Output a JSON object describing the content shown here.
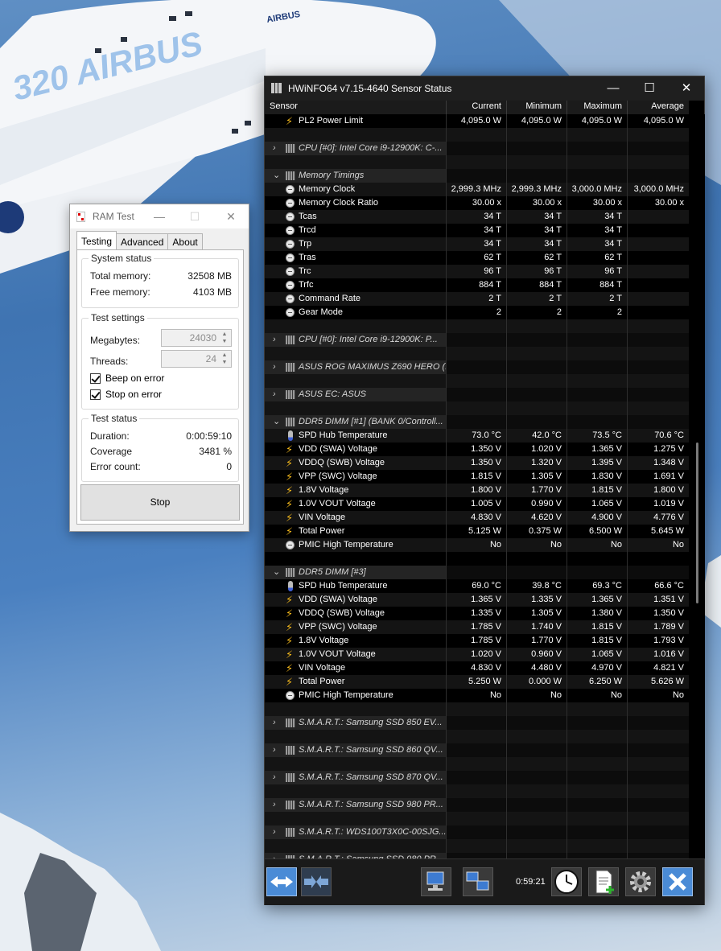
{
  "desktop": {
    "livery_large": "320 AIRBUS",
    "livery_small": "AIRBUS"
  },
  "ramtest": {
    "title": "RAM Test",
    "tabs": [
      "Testing",
      "Advanced",
      "About"
    ],
    "system_status": {
      "label": "System status",
      "total_label": "Total memory:",
      "total_value": "32508 MB",
      "free_label": "Free memory:",
      "free_value": "4103 MB"
    },
    "test_settings": {
      "label": "Test settings",
      "megabytes_label": "Megabytes:",
      "megabytes_value": "24030",
      "threads_label": "Threads:",
      "threads_value": "24",
      "beep_label": "Beep on error",
      "beep_checked": true,
      "stop_label": "Stop on error",
      "stop_checked": true
    },
    "test_status": {
      "label": "Test status",
      "duration_label": "Duration:",
      "duration_value": "0:00:59:10",
      "coverage_label": "Coverage",
      "coverage_value": "3481 %",
      "errors_label": "Error count:",
      "errors_value": "0"
    },
    "stop_button": "Stop"
  },
  "hwinfo": {
    "title": "HWiNFO64 v7.15-4640 Sensor Status",
    "columns": [
      "Sensor",
      "Current",
      "Minimum",
      "Maximum",
      "Average"
    ],
    "timer": "0:59:21",
    "rows": [
      {
        "type": "sensor",
        "icon": "bolt",
        "name": "PL2 Power Limit",
        "v": [
          "4,095.0 W",
          "4,095.0 W",
          "4,095.0 W",
          "4,095.0 W"
        ]
      },
      {
        "type": "blank"
      },
      {
        "type": "group",
        "expanded": false,
        "name": "CPU [#0]: Intel Core i9-12900K: C-..."
      },
      {
        "type": "blank"
      },
      {
        "type": "group",
        "expanded": true,
        "name": "Memory Timings"
      },
      {
        "type": "sensor",
        "icon": "clock",
        "name": "Memory Clock",
        "v": [
          "2,999.3 MHz",
          "2,999.3 MHz",
          "3,000.0 MHz",
          "3,000.0 MHz"
        ]
      },
      {
        "type": "sensor",
        "icon": "clock",
        "name": "Memory Clock Ratio",
        "v": [
          "30.00 x",
          "30.00 x",
          "30.00 x",
          "30.00 x"
        ]
      },
      {
        "type": "sensor",
        "icon": "clock",
        "name": "Tcas",
        "v": [
          "34 T",
          "34 T",
          "34 T",
          ""
        ]
      },
      {
        "type": "sensor",
        "icon": "clock",
        "name": "Trcd",
        "v": [
          "34 T",
          "34 T",
          "34 T",
          ""
        ]
      },
      {
        "type": "sensor",
        "icon": "clock",
        "name": "Trp",
        "v": [
          "34 T",
          "34 T",
          "34 T",
          ""
        ]
      },
      {
        "type": "sensor",
        "icon": "clock",
        "name": "Tras",
        "v": [
          "62 T",
          "62 T",
          "62 T",
          ""
        ]
      },
      {
        "type": "sensor",
        "icon": "clock",
        "name": "Trc",
        "v": [
          "96 T",
          "96 T",
          "96 T",
          ""
        ]
      },
      {
        "type": "sensor",
        "icon": "clock",
        "name": "Trfc",
        "v": [
          "884 T",
          "884 T",
          "884 T",
          ""
        ]
      },
      {
        "type": "sensor",
        "icon": "clock",
        "name": "Command Rate",
        "v": [
          "2 T",
          "2 T",
          "2 T",
          ""
        ]
      },
      {
        "type": "sensor",
        "icon": "clock",
        "name": "Gear Mode",
        "v": [
          "2",
          "2",
          "2",
          ""
        ]
      },
      {
        "type": "blank"
      },
      {
        "type": "group",
        "expanded": false,
        "name": "CPU [#0]: Intel Core i9-12900K: P..."
      },
      {
        "type": "blank"
      },
      {
        "type": "group",
        "expanded": false,
        "name": "ASUS ROG MAXIMUS Z690 HERO (..."
      },
      {
        "type": "blank"
      },
      {
        "type": "group",
        "expanded": false,
        "name": "ASUS EC: ASUS"
      },
      {
        "type": "blank"
      },
      {
        "type": "group",
        "expanded": true,
        "name": "DDR5 DIMM [#1] (BANK 0/Controll..."
      },
      {
        "type": "sensor",
        "icon": "therm",
        "name": "SPD Hub Temperature",
        "v": [
          "73.0 °C",
          "42.0 °C",
          "73.5 °C",
          "70.6 °C"
        ]
      },
      {
        "type": "sensor",
        "icon": "bolt",
        "name": "VDD (SWA) Voltage",
        "v": [
          "1.350 V",
          "1.020 V",
          "1.365 V",
          "1.275 V"
        ]
      },
      {
        "type": "sensor",
        "icon": "bolt",
        "name": "VDDQ (SWB) Voltage",
        "v": [
          "1.350 V",
          "1.320 V",
          "1.395 V",
          "1.348 V"
        ]
      },
      {
        "type": "sensor",
        "icon": "bolt",
        "name": "VPP (SWC) Voltage",
        "v": [
          "1.815 V",
          "1.305 V",
          "1.830 V",
          "1.691 V"
        ]
      },
      {
        "type": "sensor",
        "icon": "bolt",
        "name": "1.8V Voltage",
        "v": [
          "1.800 V",
          "1.770 V",
          "1.815 V",
          "1.800 V"
        ]
      },
      {
        "type": "sensor",
        "icon": "bolt",
        "name": "1.0V VOUT Voltage",
        "v": [
          "1.005 V",
          "0.990 V",
          "1.065 V",
          "1.019 V"
        ]
      },
      {
        "type": "sensor",
        "icon": "bolt",
        "name": "VIN Voltage",
        "v": [
          "4.830 V",
          "4.620 V",
          "4.900 V",
          "4.776 V"
        ]
      },
      {
        "type": "sensor",
        "icon": "bolt",
        "name": "Total Power",
        "v": [
          "5.125 W",
          "0.375 W",
          "6.500 W",
          "5.645 W"
        ]
      },
      {
        "type": "sensor",
        "icon": "clock",
        "name": "PMIC High Temperature",
        "v": [
          "No",
          "No",
          "No",
          "No"
        ]
      },
      {
        "type": "blank"
      },
      {
        "type": "group",
        "expanded": true,
        "name": "DDR5 DIMM [#3]"
      },
      {
        "type": "sensor",
        "icon": "therm",
        "name": "SPD Hub Temperature",
        "v": [
          "69.0 °C",
          "39.8 °C",
          "69.3 °C",
          "66.6 °C"
        ]
      },
      {
        "type": "sensor",
        "icon": "bolt",
        "name": "VDD (SWA) Voltage",
        "v": [
          "1.365 V",
          "1.335 V",
          "1.365 V",
          "1.351 V"
        ]
      },
      {
        "type": "sensor",
        "icon": "bolt",
        "name": "VDDQ (SWB) Voltage",
        "v": [
          "1.335 V",
          "1.305 V",
          "1.380 V",
          "1.350 V"
        ]
      },
      {
        "type": "sensor",
        "icon": "bolt",
        "name": "VPP (SWC) Voltage",
        "v": [
          "1.785 V",
          "1.740 V",
          "1.815 V",
          "1.789 V"
        ]
      },
      {
        "type": "sensor",
        "icon": "bolt",
        "name": "1.8V Voltage",
        "v": [
          "1.785 V",
          "1.770 V",
          "1.815 V",
          "1.793 V"
        ]
      },
      {
        "type": "sensor",
        "icon": "bolt",
        "name": "1.0V VOUT Voltage",
        "v": [
          "1.020 V",
          "0.960 V",
          "1.065 V",
          "1.016 V"
        ]
      },
      {
        "type": "sensor",
        "icon": "bolt",
        "name": "VIN Voltage",
        "v": [
          "4.830 V",
          "4.480 V",
          "4.970 V",
          "4.821 V"
        ]
      },
      {
        "type": "sensor",
        "icon": "bolt",
        "name": "Total Power",
        "v": [
          "5.250 W",
          "0.000 W",
          "6.250 W",
          "5.626 W"
        ]
      },
      {
        "type": "sensor",
        "icon": "clock",
        "name": "PMIC High Temperature",
        "v": [
          "No",
          "No",
          "No",
          "No"
        ]
      },
      {
        "type": "blank"
      },
      {
        "type": "group",
        "expanded": false,
        "name": "S.M.A.R.T.: Samsung SSD 850 EV..."
      },
      {
        "type": "blank"
      },
      {
        "type": "group",
        "expanded": false,
        "name": "S.M.A.R.T.: Samsung SSD 860 QV..."
      },
      {
        "type": "blank"
      },
      {
        "type": "group",
        "expanded": false,
        "name": "S.M.A.R.T.: Samsung SSD 870 QV..."
      },
      {
        "type": "blank"
      },
      {
        "type": "group",
        "expanded": false,
        "name": "S.M.A.R.T.: Samsung SSD 980 PR..."
      },
      {
        "type": "blank"
      },
      {
        "type": "group",
        "expanded": false,
        "name": "S.M.A.R.T.: WDS100T3X0C-00SJG..."
      },
      {
        "type": "blank"
      },
      {
        "type": "group",
        "expanded": false,
        "name": "S.M.A.R.T.: Samsung SSD 980 PR..."
      }
    ],
    "toolbar": [
      "expand-arrows-icon",
      "collapse-arrows-icon",
      "network-computer-icon",
      "computers-link-icon",
      "clock-icon",
      "add-report-icon",
      "settings-gear-icon",
      "close-x-icon"
    ]
  }
}
